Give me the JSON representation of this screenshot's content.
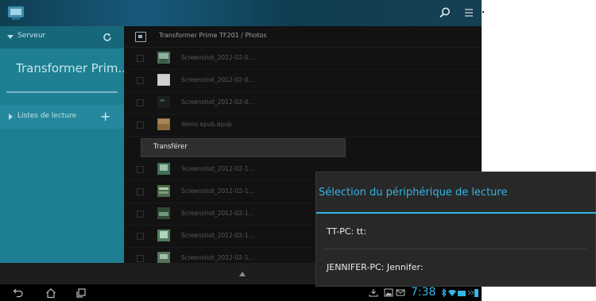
{
  "sidebar": {
    "server_label": "Serveur",
    "device_name": "Transformer Prim...",
    "playlists_label": "Listes de lecture",
    "plus_glyph": "+"
  },
  "filelist": {
    "path": "Transformer Prime TF201 / Photos",
    "items": [
      {
        "name": "Screenshot_2012-02-0..."
      },
      {
        "name": "Screenshot_2012-02-0..."
      },
      {
        "name": "Screenshot_2012-02-0..."
      },
      {
        "name": "demo epub.epub"
      },
      {
        "name": "Screenshot_2012-02-1..."
      },
      {
        "name": "Screenshot_2012-02-1..."
      },
      {
        "name": "Screenshot_2012-02-1..."
      },
      {
        "name": "Screenshot_2012-02-1..."
      },
      {
        "name": "Screenshot_2012-02-1..."
      }
    ]
  },
  "context_menu": {
    "transfer_label": "Transférer"
  },
  "dialog": {
    "title": "Sélection du périphérique de lecture",
    "options": [
      {
        "label": "TT-PC: tt:"
      },
      {
        "label": "JENNIFER-PC: Jennifer:"
      }
    ]
  },
  "statusbar": {
    "time": "7:38"
  },
  "colors": {
    "accent": "#33b5e5",
    "sidebar": "#1e7f93",
    "actionbar": "#18597a"
  },
  "icons": {
    "app": "media-app-icon",
    "search": "search-icon",
    "menu": "overflow-menu-icon",
    "refresh": "refresh-icon",
    "back": "back-icon",
    "home": "home-icon",
    "recents": "recent-apps-icon"
  }
}
